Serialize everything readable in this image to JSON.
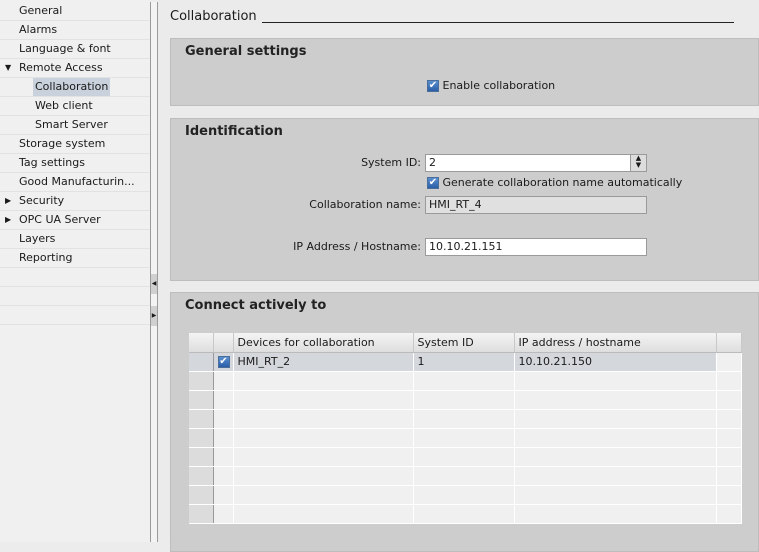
{
  "sidebar": {
    "items": [
      {
        "label": "General"
      },
      {
        "label": "Alarms"
      },
      {
        "label": "Language & font"
      },
      {
        "label": "Remote Access",
        "expander": "expanded"
      },
      {
        "label": "Collaboration",
        "selected": true
      },
      {
        "label": "Web client"
      },
      {
        "label": "Smart Server"
      },
      {
        "label": "Storage system"
      },
      {
        "label": "Tag settings"
      },
      {
        "label": "Good Manufacturin..."
      },
      {
        "label": "Security",
        "expander": "collapsed"
      },
      {
        "label": "OPC UA Server",
        "expander": "collapsed"
      },
      {
        "label": "Layers"
      },
      {
        "label": "Reporting"
      }
    ]
  },
  "page": {
    "title": "Collaboration"
  },
  "general": {
    "heading": "General settings",
    "enable_label": "Enable collaboration",
    "enable_checked": true
  },
  "identification": {
    "heading": "Identification",
    "system_id_label": "System ID:",
    "system_id": "2",
    "auto_name_label": "Generate collaboration name automatically",
    "auto_name_checked": true,
    "name_label": "Collaboration name:",
    "name": "HMI_RT_4",
    "ip_label": "IP Address / Hostname:",
    "ip": "10.10.21.151"
  },
  "connect": {
    "heading": "Connect actively to",
    "columns": [
      "Devices for collaboration",
      "System ID",
      "IP address / hostname"
    ],
    "rows": [
      {
        "checked": true,
        "device": "HMI_RT_2",
        "system_id": "1",
        "ip": "10.10.21.150"
      }
    ]
  }
}
